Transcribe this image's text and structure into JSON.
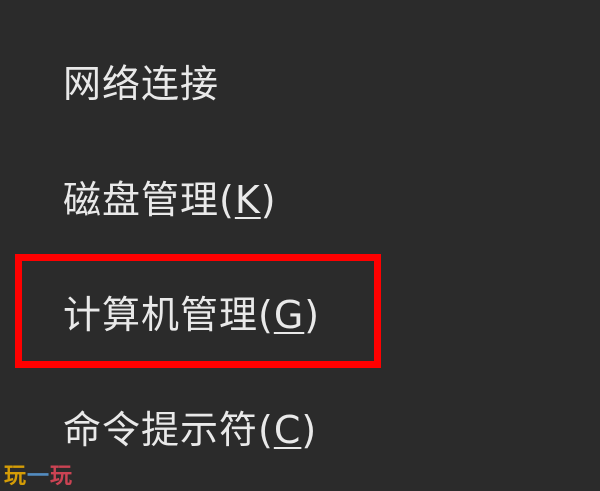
{
  "menu": {
    "items": [
      {
        "text": "网络连接",
        "mnemonic": ""
      },
      {
        "text": "磁盘管理(",
        "mnemonic": "K",
        "suffix": ")"
      },
      {
        "text": "计算机管理(",
        "mnemonic": "G",
        "suffix": ")"
      },
      {
        "text": "命令提示符(",
        "mnemonic": "C",
        "suffix": ")"
      }
    ]
  },
  "highlight": {
    "color": "#ff0000"
  },
  "watermark": {
    "part1": "玩",
    "part2": "一",
    "part3": "玩"
  },
  "colors": {
    "background": "#2b2b2b",
    "text": "#e9e9e9",
    "highlight": "#ff0000"
  }
}
